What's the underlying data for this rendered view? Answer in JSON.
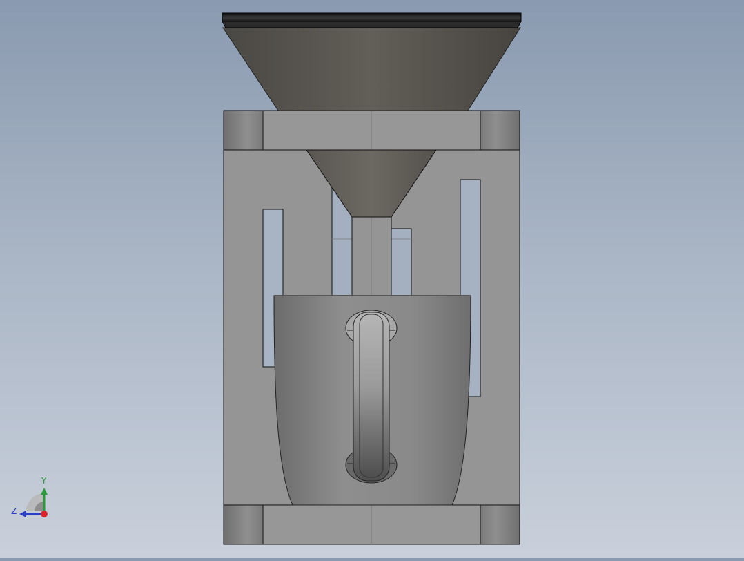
{
  "view": {
    "background_top": "#8a9ab0",
    "background_bottom": "#c9d0db",
    "model": "coffee-maker-assembly"
  },
  "triad": {
    "y_label": "Y",
    "z_label": "Z",
    "x_color": "#d8262c",
    "y_color": "#2a9a3a",
    "z_color": "#2a3fc2"
  }
}
